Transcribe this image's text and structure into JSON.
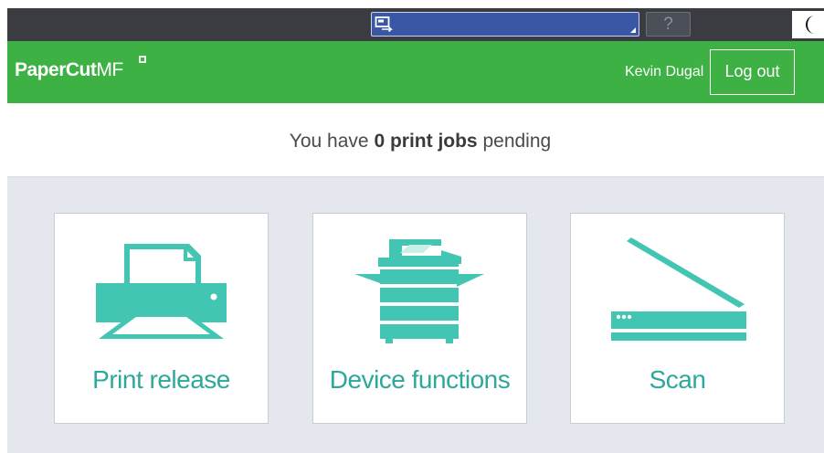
{
  "system_bar": {
    "help_label": "?",
    "accent_color": "#3a57a6"
  },
  "header": {
    "brand": "PaperCut",
    "brand_suffix": "MF",
    "user_name": "Kevin Dugal",
    "logout_label": "Log out",
    "color": "#3db144"
  },
  "status": {
    "prefix": "You have ",
    "count_text": "0 print jobs",
    "suffix": " pending"
  },
  "tiles": [
    {
      "label": "Print release",
      "icon": "printer-icon"
    },
    {
      "label": "Device functions",
      "icon": "copier-icon"
    },
    {
      "label": "Scan",
      "icon": "scanner-icon"
    }
  ],
  "theme": {
    "icon_color": "#42c5b3",
    "label_color": "#2ea89a",
    "tile_area_bg": "#e4e8ee"
  }
}
